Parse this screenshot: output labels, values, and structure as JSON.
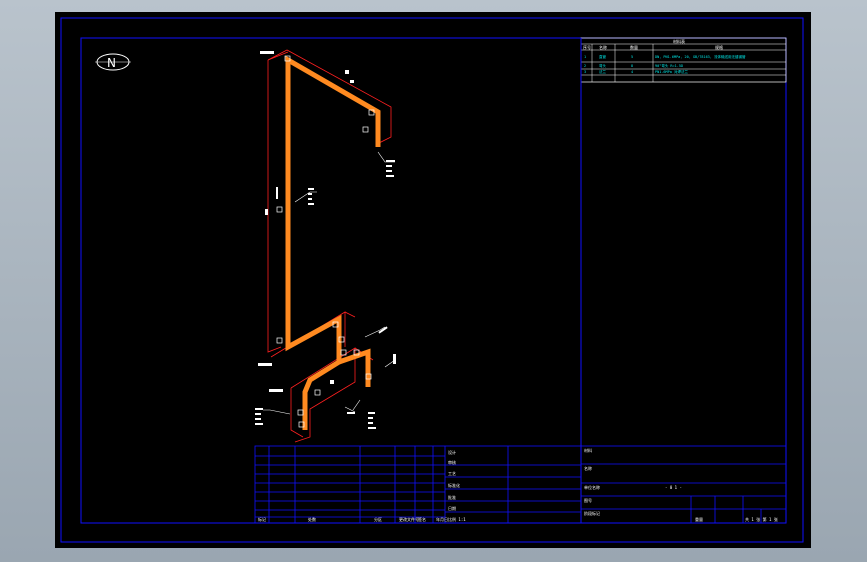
{
  "north_arrow": {
    "letter": "N"
  },
  "colors": {
    "background": "#000000",
    "frame": "#1010ff",
    "pipe": "#ff8a20",
    "dimension": "#ff2020",
    "annotation": "#ffffff",
    "table_text": "#00e5e5"
  },
  "legend_table": {
    "title": "材料表",
    "headers": [
      "序号",
      "名称",
      "数量",
      "规格"
    ],
    "rows": [
      [
        "1",
        "直管",
        "5",
        "DN, PN1.6MPa, 20, GB/T8163, 流体输送用无缝钢管"
      ],
      [
        "2",
        "弯头",
        "8",
        "90°弯头 R=1.5D"
      ],
      [
        "3",
        "法兰",
        "4",
        "PN1.6MPa 对焊法兰"
      ]
    ]
  },
  "title_block": {
    "left_bottom_labels": [
      "标记",
      "处数",
      "分区",
      "更改文件号",
      "签名",
      "年月日"
    ],
    "middle_labels": [
      "设计",
      "审核",
      "工艺",
      "标准化",
      "批准",
      "日期"
    ],
    "middle_bottom": "比例 1:1",
    "right_labels": [
      "材料",
      "名称",
      "单位名称",
      "图号",
      "阶段标记",
      "重量"
    ],
    "code": "- 0 1 -",
    "sheet": "共 1 张 第 1 张"
  }
}
